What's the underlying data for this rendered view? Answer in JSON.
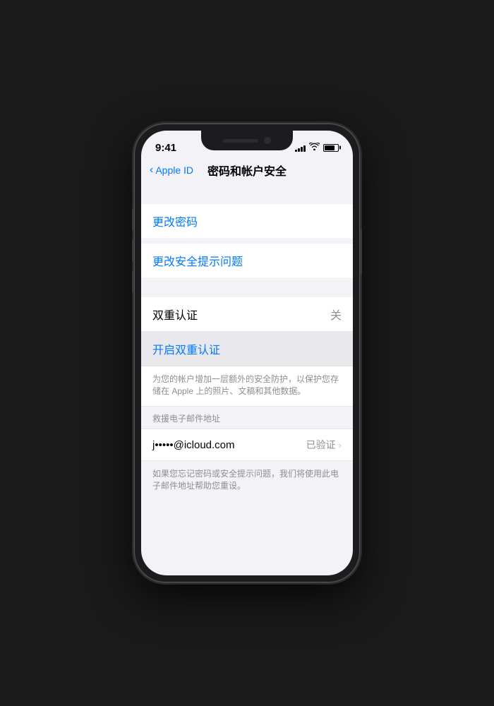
{
  "statusBar": {
    "time": "9:41",
    "signal": [
      3,
      5,
      7,
      9,
      11
    ],
    "batteryLevel": 80
  },
  "navigation": {
    "backLabel": "Apple ID",
    "title": "密码和帐户安全"
  },
  "sections": {
    "changePassword": {
      "label": "更改密码"
    },
    "changeSecurityQuestions": {
      "label": "更改安全提示问题"
    },
    "twoFactor": {
      "label": "双重认证",
      "value": "关",
      "enableLabel": "开启双重认证",
      "description": "为您的帐户增加一层额外的安全防护，以保护您存储在 Apple 上的照片、文稿和其他数据。"
    },
    "rescueEmail": {
      "headerLabel": "救援电子邮件地址",
      "email": "j•••••@icloud.com",
      "verifiedLabel": "已验证",
      "footerText": "如果您忘记密码或安全提示问题，我们将使用此电子邮件地址帮助您重设。"
    }
  }
}
